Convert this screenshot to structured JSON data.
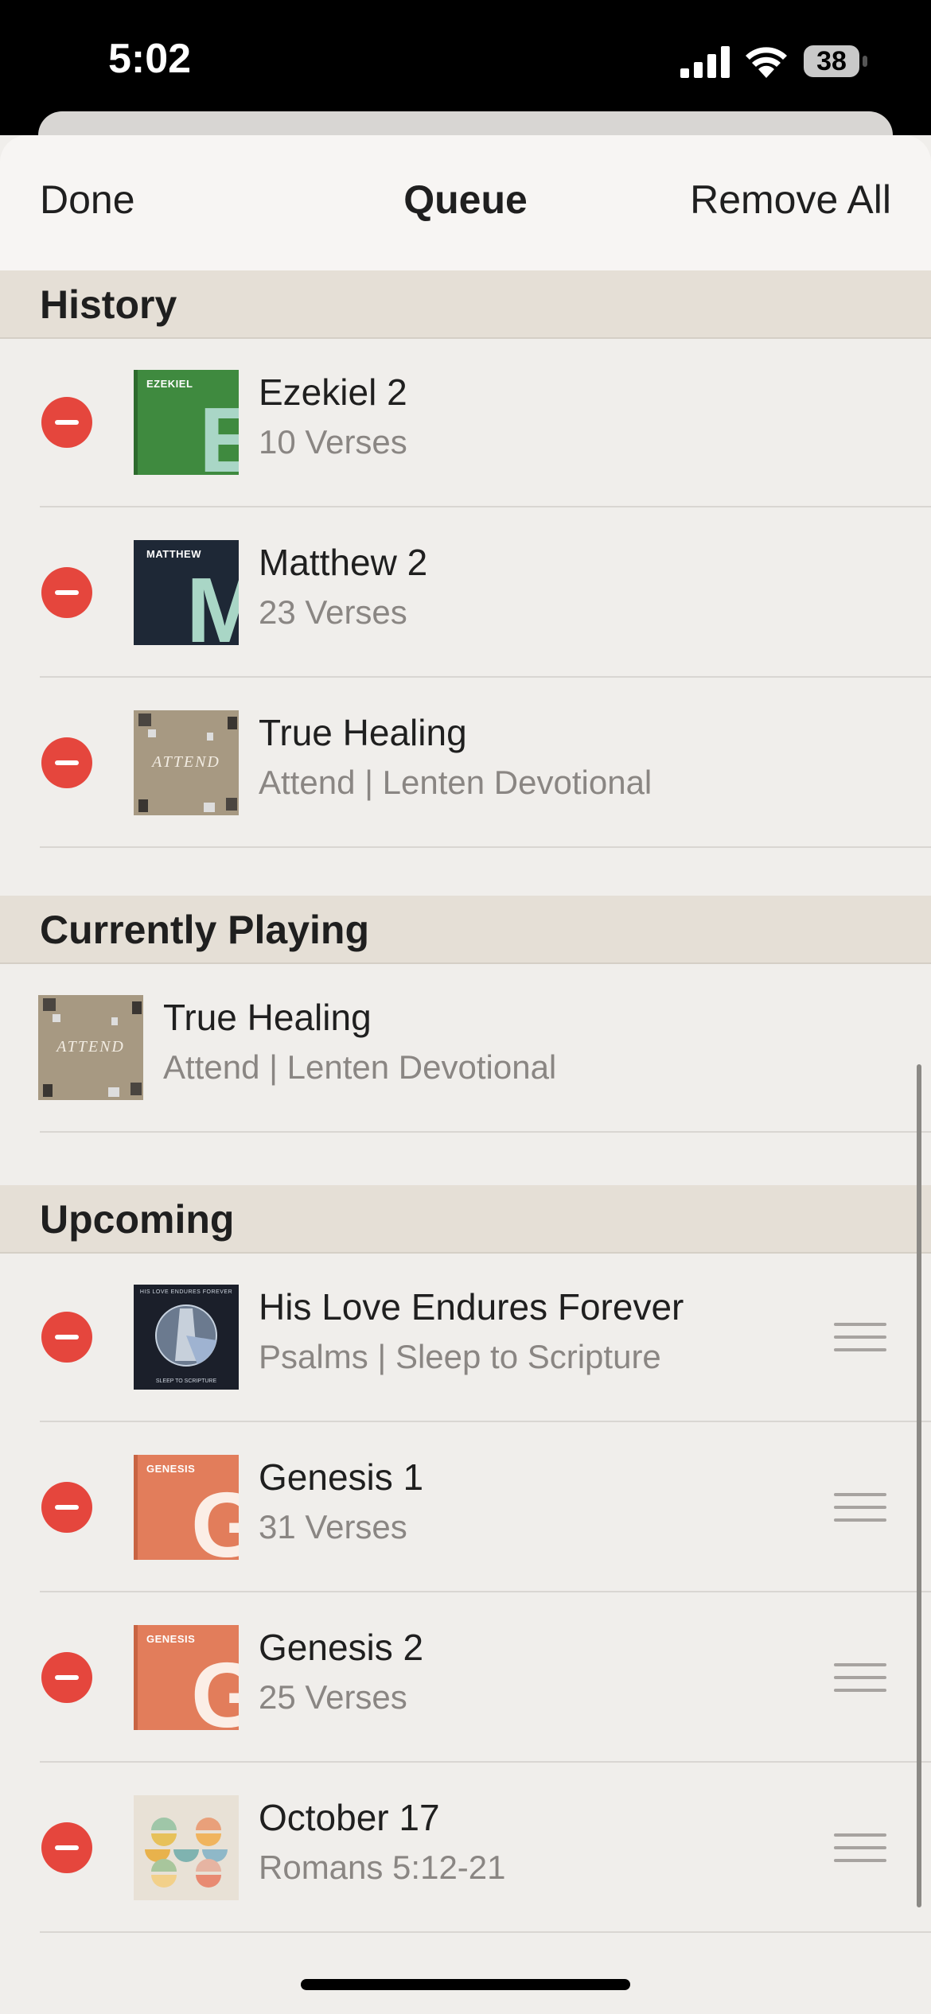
{
  "status_bar": {
    "time": "5:02",
    "battery": "38"
  },
  "nav": {
    "done_label": "Done",
    "title": "Queue",
    "remove_all_label": "Remove All"
  },
  "sections": {
    "history": {
      "title": "History",
      "items": [
        {
          "title": "Ezekiel 2",
          "subtitle": "10 Verses",
          "art_label": "EZEKIEL",
          "art_letter": "E",
          "art_color": "#3f8a3f"
        },
        {
          "title": "Matthew 2",
          "subtitle": "23 Verses",
          "art_label": "MATTHEW",
          "art_letter": "M",
          "art_color": "#1e2836"
        },
        {
          "title": "True Healing",
          "subtitle": "Attend | Lenten Devotional",
          "art_label": "ATTEND",
          "art_color": "#a79982"
        }
      ]
    },
    "currently_playing": {
      "title": "Currently Playing",
      "items": [
        {
          "title": "True Healing",
          "subtitle": "Attend | Lenten Devotional",
          "art_label": "ATTEND",
          "art_color": "#a79982"
        }
      ]
    },
    "upcoming": {
      "title": "Upcoming",
      "items": [
        {
          "title": "His Love Endures Forever",
          "subtitle": "Psalms | Sleep to Scripture",
          "art_top": "HIS LOVE ENDURES FOREVER",
          "art_bottom": "SLEEP TO SCRIPTURE",
          "art_color": "#1b1f2a"
        },
        {
          "title": "Genesis 1",
          "subtitle": "31 Verses",
          "art_label": "GENESIS",
          "art_letter": "G",
          "art_color": "#e27d5b"
        },
        {
          "title": "Genesis 2",
          "subtitle": "25 Verses",
          "art_label": "GENESIS",
          "art_letter": "G",
          "art_color": "#e27d5b"
        },
        {
          "title": "October 17",
          "subtitle": "Romans 5:12-21",
          "art_color": "#e8e1d6"
        }
      ]
    }
  },
  "colors": {
    "remove": "#e5463d",
    "section_bg": "#e5dfd6",
    "background": "#f0eeeb"
  }
}
